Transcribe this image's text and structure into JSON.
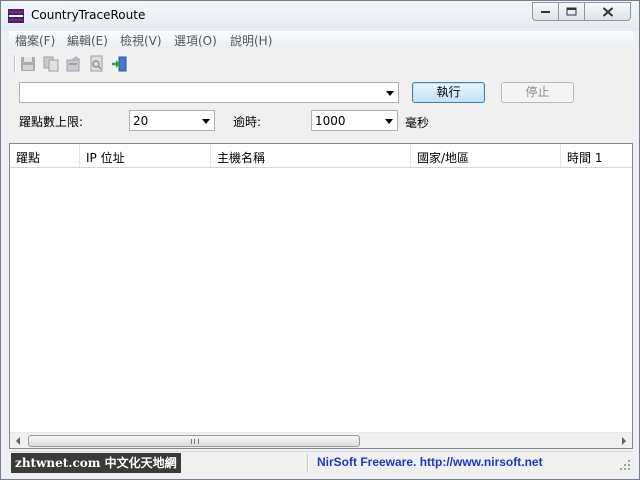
{
  "window": {
    "title": "CountryTraceRoute"
  },
  "menu": [
    "檔案(F)",
    "編輯(E)",
    "檢視(V)",
    "選項(O)",
    "說明(H)"
  ],
  "toolbar": {
    "icons": [
      "save-icon",
      "copy-icon",
      "properties-icon",
      "report-icon",
      "exit-icon"
    ]
  },
  "address": {
    "value": ""
  },
  "buttons": {
    "run": "執行",
    "stop": "停止"
  },
  "hops": {
    "label": "躍點數上限:",
    "value": "20"
  },
  "timeout": {
    "label": "逾時:",
    "value": "1000",
    "unit": "毫秒"
  },
  "columns": [
    "躍點",
    "IP 位址",
    "主機名稱",
    "國家/地區",
    "時間 1"
  ],
  "status": {
    "left": "zhtwnet.com 中文化天地網",
    "right": "NirSoft Freeware.  http://www.nirsoft.net"
  },
  "colors": {
    "accent": "#3c7fb1",
    "link": "#1a39c4"
  }
}
